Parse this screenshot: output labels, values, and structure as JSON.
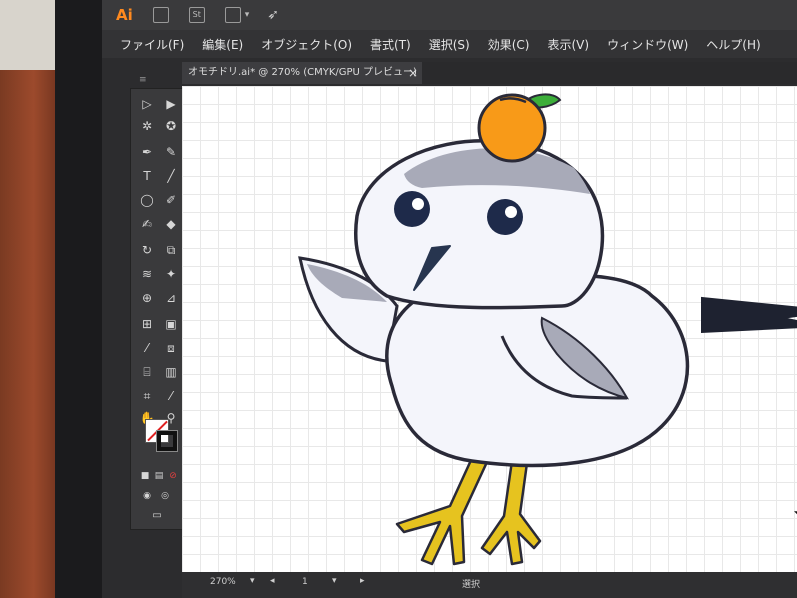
{
  "app": {
    "logo": "Ai",
    "bridge_label": "St",
    "caret": "▾"
  },
  "menu": [
    "ファイル(F)",
    "編集(E)",
    "オブジェクト(O)",
    "書式(T)",
    "選択(S)",
    "効果(C)",
    "表示(V)",
    "ウィンドウ(W)",
    "ヘルプ(H)"
  ],
  "tab": {
    "title": "オモチドリ.ai* @ 270% (CMYK/GPU プレビュー)",
    "close": "×"
  },
  "status": {
    "zoom": "270%",
    "zoom_caret": "▾",
    "prev": "◂",
    "page": "1",
    "page_caret": "▾",
    "next": "▸",
    "mode": "選択"
  },
  "colors": {
    "bird_body": "#f4f5fb",
    "bird_outline": "#2a2a38",
    "bird_gray": "#a8aab8",
    "eye": "#1e2a4a",
    "beak": "#27354f",
    "orange": "#f89a18",
    "leaf": "#3cae3a",
    "legs": "#e6c31f",
    "tail": "#1e2230"
  }
}
